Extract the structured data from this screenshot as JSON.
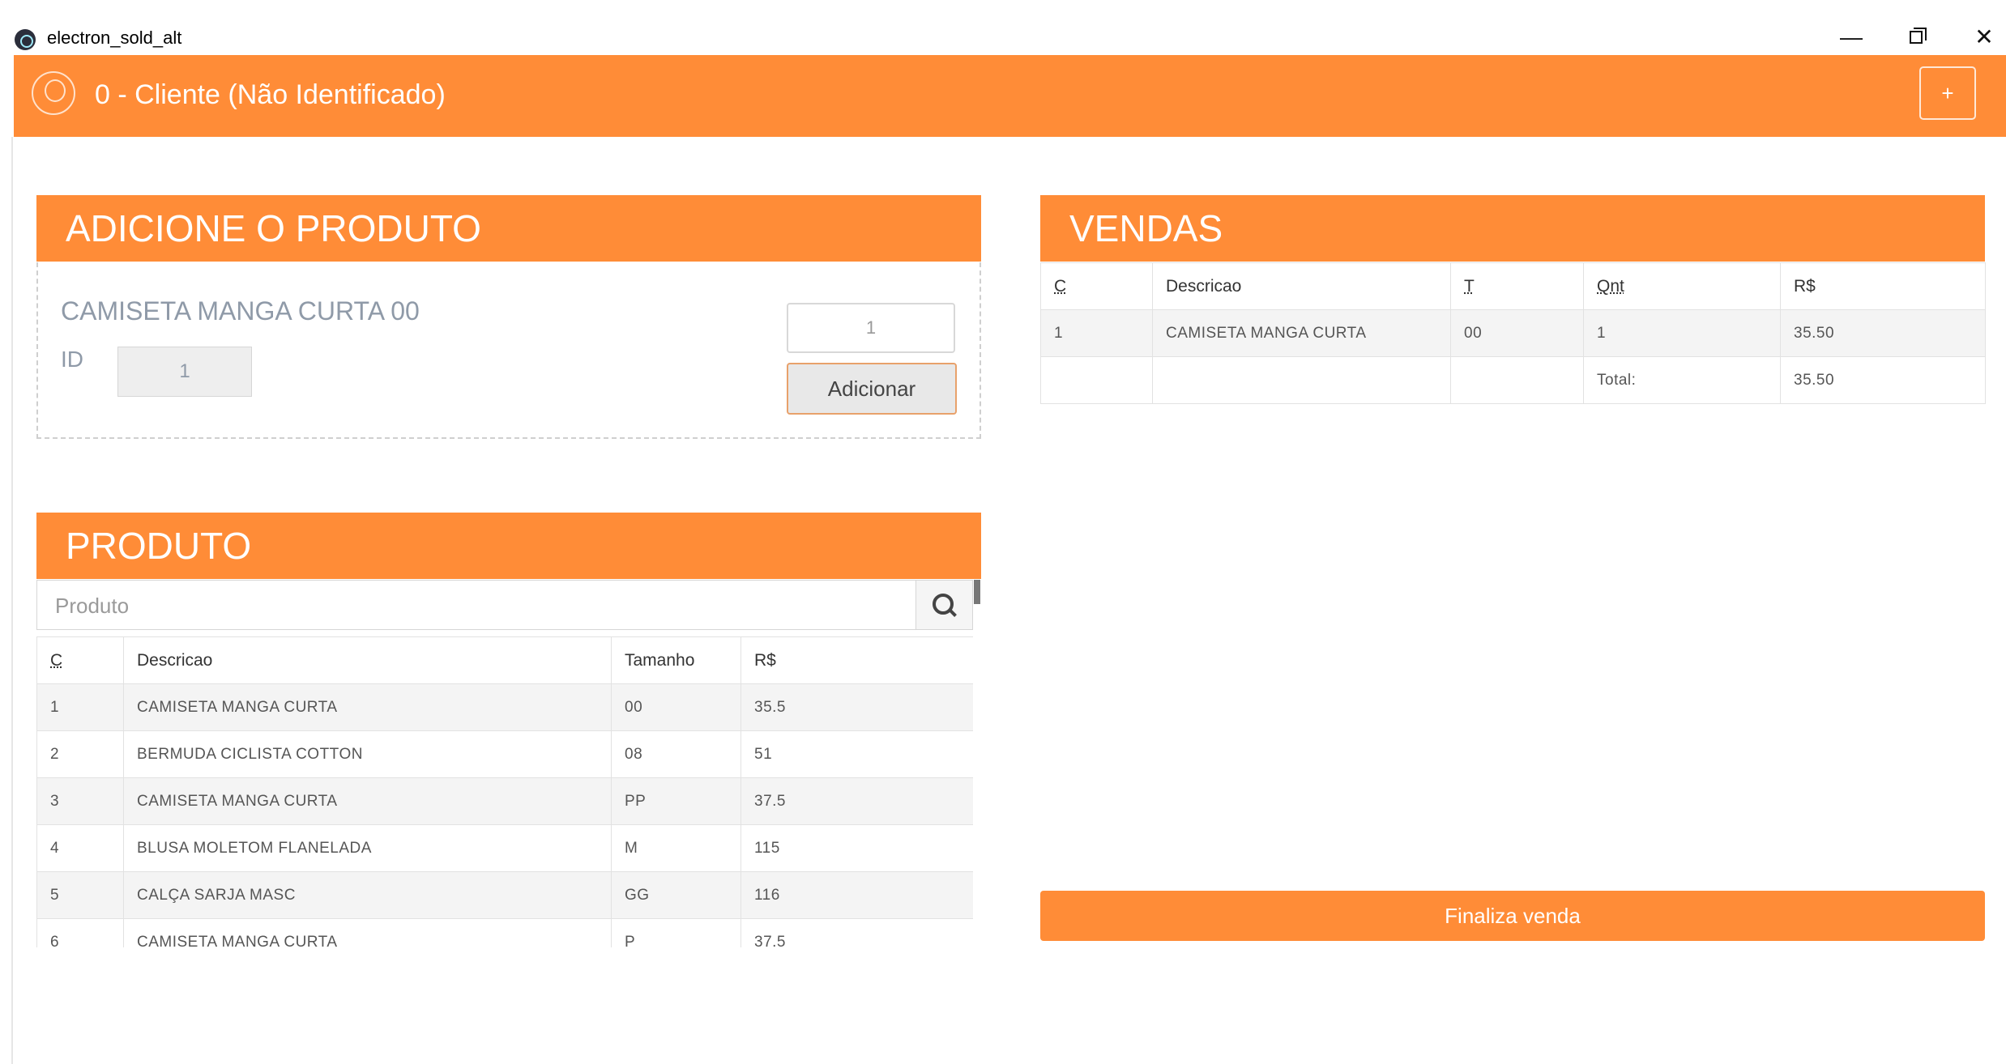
{
  "window": {
    "title": "electron_sold_alt",
    "minimize_label": "—",
    "close_label": "✕"
  },
  "header": {
    "customer": "0 - Cliente (Não Identificado)",
    "add_label": "+"
  },
  "add_product": {
    "title": "ADICIONE O PRODUTO",
    "product_name": "CAMISETA MANGA CURTA 00",
    "id_label": "ID",
    "id_value": "1",
    "quantity": "1",
    "add_button": "Adicionar"
  },
  "products": {
    "title": "PRODUTO",
    "search_placeholder": "Produto",
    "columns": [
      "C",
      "Descricao",
      "Tamanho",
      "R$"
    ],
    "rows": [
      [
        "1",
        "CAMISETA MANGA CURTA",
        "00",
        "35.5"
      ],
      [
        "2",
        "BERMUDA CICLISTA COTTON",
        "08",
        "51"
      ],
      [
        "3",
        "CAMISETA MANGA CURTA",
        "PP",
        "37.5"
      ],
      [
        "4",
        "BLUSA MOLETOM FLANELADA",
        "M",
        "115"
      ],
      [
        "5",
        "CALÇA SARJA MASC",
        "GG",
        "116"
      ],
      [
        "6",
        "CAMISETA MANGA CURTA",
        "P",
        "37.5"
      ]
    ]
  },
  "sales": {
    "title": "VENDAS",
    "columns": [
      "C",
      "Descricao",
      "T",
      "Qnt",
      "R$"
    ],
    "rows": [
      [
        "1",
        "CAMISETA MANGA CURTA",
        "00",
        "1",
        "35.50"
      ]
    ],
    "total_label": "Total:",
    "total_value": "35.50",
    "finalize_button": "Finaliza venda"
  },
  "colors": {
    "accent": "#ff8c37"
  }
}
